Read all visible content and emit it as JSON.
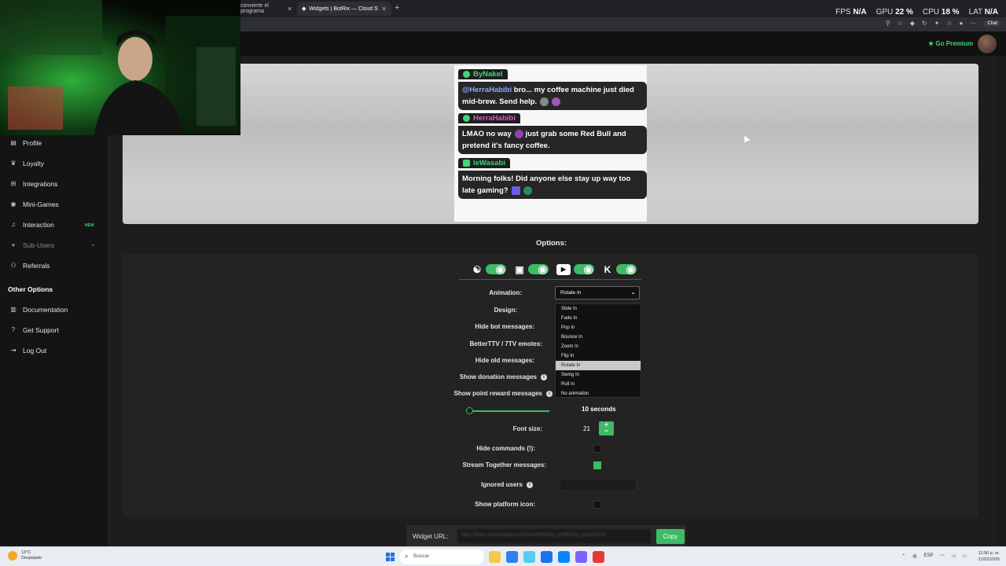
{
  "browser": {
    "tabs": [
      {
        "label": "convierte el programa"
      },
      {
        "label": "Widgets | BotRix — Cloud Stream"
      }
    ],
    "new_tab": "+",
    "stats": {
      "fps_label": "FPS",
      "fps_value": "N/A",
      "gpu_label": "GPU",
      "gpu_value": "22 %",
      "cpu_label": "CPU",
      "cpu_value": "18 %",
      "lat_label": "LAT",
      "lat_value": "N/A"
    },
    "chat_pill": "Chat"
  },
  "header": {
    "premium_label": "Go Premium"
  },
  "sidebar": {
    "items": [
      {
        "label": "Profile",
        "icon": "id-card-icon"
      },
      {
        "label": "Loyalty",
        "icon": "trophy-icon"
      },
      {
        "label": "Integrations",
        "icon": "plug-icon"
      },
      {
        "label": "Mini-Games",
        "icon": "gamepad-icon"
      },
      {
        "label": "Interaction",
        "icon": "music-icon",
        "badge": "NEW"
      },
      {
        "label": "Sub-Users",
        "icon": "users-icon"
      },
      {
        "label": "Referrals",
        "icon": "referral-icon"
      }
    ],
    "other_header": "Other Options",
    "other_items": [
      {
        "label": "Documentation",
        "icon": "book-icon"
      },
      {
        "label": "Get Support",
        "icon": "question-icon"
      },
      {
        "label": "Log Out",
        "icon": "logout-icon"
      }
    ]
  },
  "preview": {
    "messages": [
      {
        "user": "ByNakel",
        "user_color": "#3ed67a",
        "mention": "@HerraHabibi",
        "text": " bro... my coffee machine just died mid-brew. Send help."
      },
      {
        "user": "HerraHabibi",
        "user_color": "#e056c8",
        "text": "LMAO no way",
        "text2": " just grab some Red Bull and pretend it's fancy coffee."
      },
      {
        "user": "leWasabi",
        "user_color": "#3ed67a",
        "text": "Morning folks! Did anyone else stay up way too late gaming?"
      }
    ]
  },
  "options": {
    "title": "Options:",
    "animation_label": "Animation:",
    "animation_value": "Rotate In",
    "animation_options": [
      "Slide In",
      "Fade In",
      "Pop In",
      "Bounce In",
      "Zoom In",
      "Flip In",
      "Rotate In",
      "Swing In",
      "Roll In",
      "No animation"
    ],
    "design_label": "Design:",
    "hide_bot_label": "Hide bot messages:",
    "bttv_label": "BetterTTV / 7TV emotes:",
    "hide_old_label": "Hide old messages:",
    "donation_label": "Show donation messages",
    "point_reward_label": "Show point reward messages",
    "duration_value": "10 seconds",
    "font_size_label": "Font size:",
    "font_size_value": "21",
    "hide_commands_label": "Hide commands (!):",
    "stream_together_label": "Stream Together messages:",
    "ignored_users_label": "Ignored users",
    "platform_icon_label": "Show platform icon:",
    "widget_url_label": "Widget URL:",
    "widget_url_value": "https://botrix.live/widgets/chat?bid=xRf8WAq_bnM6Gnd_paramS5cXr",
    "copy_label": "Copy"
  },
  "taskbar": {
    "weather_temp": "13°C",
    "weather_desc": "Despejado",
    "search_placeholder": "Buscar",
    "lang": "ESP",
    "time": "11:56 p. m.",
    "date": "21/02/2026"
  },
  "colors": {
    "accent": "#3dbb67",
    "premium": "#3ed67a",
    "mention": "#8fa7ff"
  }
}
